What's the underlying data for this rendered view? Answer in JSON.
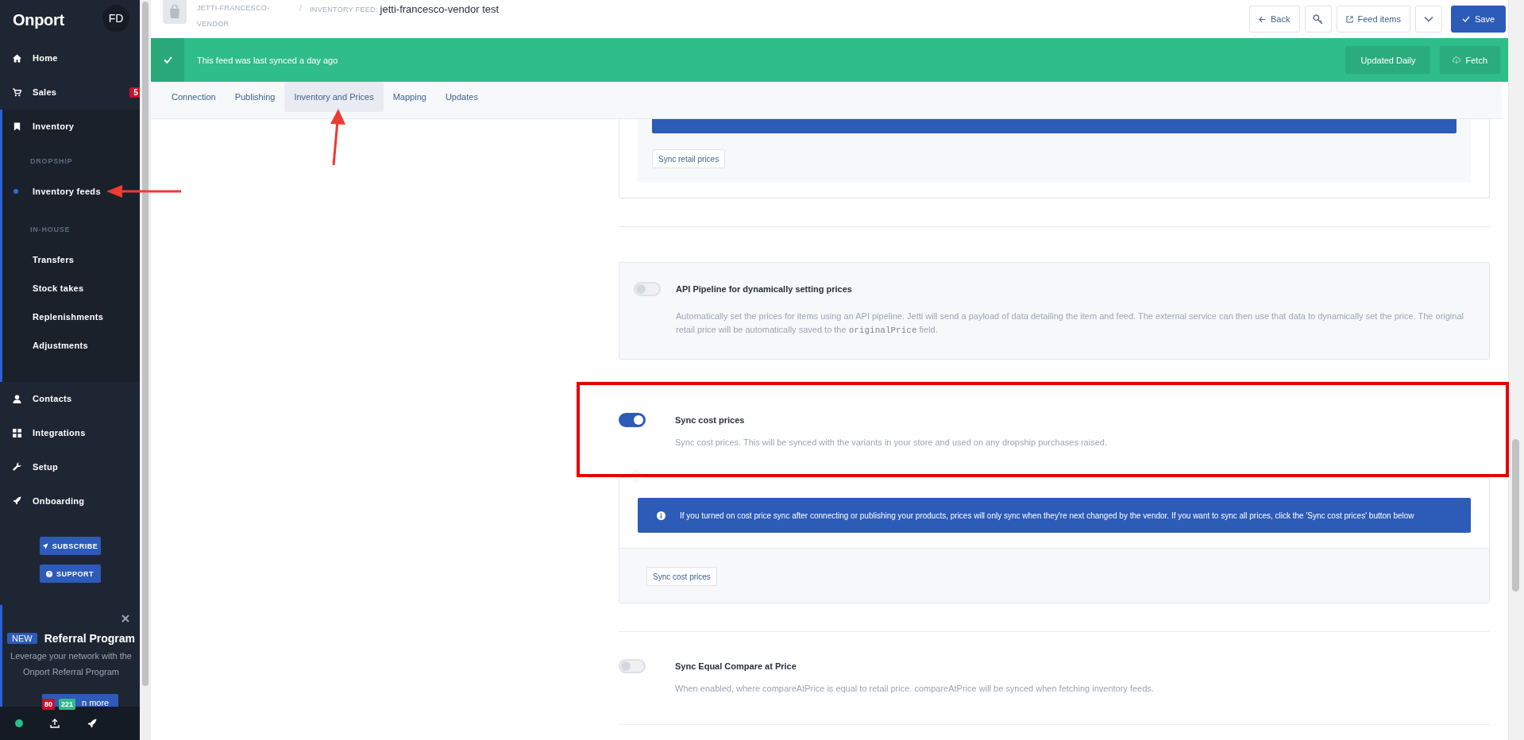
{
  "sidebar": {
    "logo": "Onport",
    "avatar": "FD",
    "nav": [
      {
        "label": "Home",
        "expanded": false
      },
      {
        "label": "Sales",
        "badge": "5",
        "expanded": false
      },
      {
        "label": "Inventory",
        "expanded": true,
        "children": [
          {
            "kind": "heading",
            "label": "DROPSHIP"
          },
          {
            "kind": "link",
            "label": "Inventory feeds",
            "selected": true
          },
          {
            "kind": "heading",
            "label": "IN-HOUSE"
          },
          {
            "kind": "link",
            "label": "Transfers",
            "selected": false
          },
          {
            "kind": "link",
            "label": "Stock takes",
            "selected": false
          },
          {
            "kind": "link",
            "label": "Replenishments",
            "selected": false
          },
          {
            "kind": "link",
            "label": "Adjustments",
            "selected": false
          }
        ]
      },
      {
        "label": "Contacts",
        "expanded": false
      },
      {
        "label": "Integrations",
        "expanded": false
      },
      {
        "label": "Setup",
        "expanded": false
      },
      {
        "label": "Onboarding",
        "expanded": false
      }
    ],
    "buttons": [
      "SUBSCRIBE",
      "SUPPORT"
    ],
    "referral": {
      "badge": "NEW",
      "title": "Referral Program",
      "text": "Leverage your network with the Onport Referral Program",
      "button": "n more"
    },
    "footer": {
      "badges": [
        {
          "text": "80",
          "color": "#c8102e"
        },
        {
          "text": "221",
          "color": "#2dbd8a"
        }
      ]
    }
  },
  "header": {
    "store": "JETTI-FRANCESCO-VENDOR",
    "separator": "/",
    "label": "INVENTORY FEED:",
    "title": "jetti-francesco-vendor test",
    "actions": [
      {
        "kind": "secondary",
        "label": "Back"
      },
      {
        "kind": "icon"
      },
      {
        "kind": "secondary",
        "label": "Feed items"
      },
      {
        "kind": "icon"
      },
      {
        "kind": "primary",
        "label": "Save"
      }
    ]
  },
  "sync_banner": {
    "message": "This feed was last synced a day ago",
    "buttons": [
      "Updated Daily",
      "Fetch"
    ]
  },
  "tabs": [
    {
      "label": "Connection",
      "selected": false
    },
    {
      "label": "Publishing",
      "selected": false
    },
    {
      "label": "Inventory and Prices",
      "selected": true
    },
    {
      "label": "Mapping",
      "selected": false
    },
    {
      "label": "Updates",
      "selected": false
    }
  ],
  "content": {
    "retail_button": "Sync retail prices",
    "settings": [
      {
        "kind": "card",
        "title": "API Pipeline for dynamically setting prices",
        "on": false,
        "description": [
          {
            "kind": "plain",
            "text": "Automatically set the prices for items using an API pipeline. Jetti will send a payload of data detailing the item and feed. The external service can then use that data to dynamically set the price. The original retail price will be automatically saved to the "
          },
          {
            "kind": "code",
            "text": "originalPrice"
          },
          {
            "kind": "plain",
            "text": " field."
          }
        ]
      },
      {
        "kind": "plain",
        "title": "Sync cost prices",
        "on": true,
        "description": [
          {
            "kind": "plain",
            "text": "Sync cost prices. This will be synced with the variants in your store and used on any dropship purchases raised."
          }
        ],
        "info": "If you turned on cost price sync after connecting or publishing your products, prices will only sync when they're next changed by the vendor. If you want to sync all prices, click the 'Sync cost prices' button below",
        "button": "Sync cost prices"
      },
      {
        "kind": "plain",
        "title": "Sync Equal Compare at Price",
        "on": false,
        "description": [
          {
            "kind": "plain",
            "text": "When enabled, where compareAtPrice is equal to retail price. compareAtPrice will be synced when fetching inventory feeds."
          }
        ]
      }
    ]
  }
}
